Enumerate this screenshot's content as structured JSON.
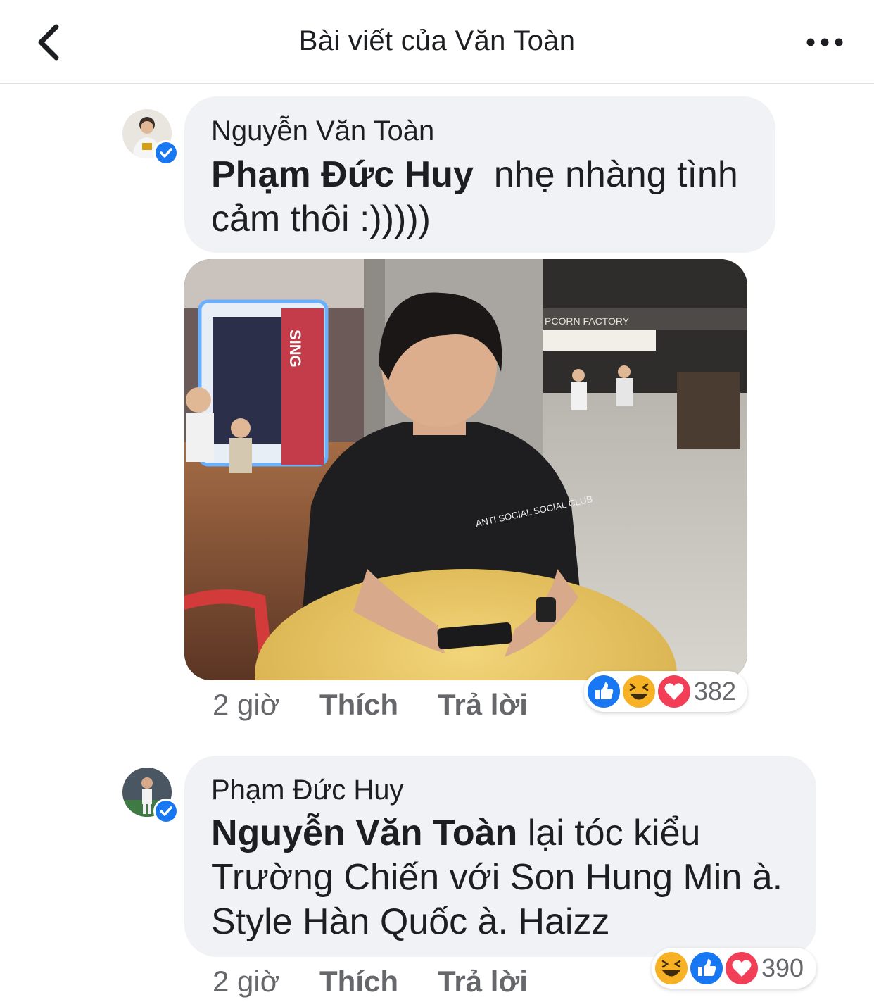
{
  "header": {
    "title": "Bài viết của Văn Toàn"
  },
  "comments": [
    {
      "author": "Nguyễn Văn Toàn",
      "mention": "Phạm Đức Huy",
      "text_line1": "  nhẹ nhàng tình",
      "text_line2": "cảm thôi :)))))",
      "has_photo": true,
      "photo_signs": {
        "sign1": "SING",
        "sign2": "PCORN FACTORY",
        "shirt": "ANTI SOCIAL SOCIAL CLUB"
      },
      "time": "2 giờ",
      "like_label": "Thích",
      "reply_label": "Trả lời",
      "reactions": [
        "like-icon",
        "haha-icon",
        "love-icon"
      ],
      "reaction_count": "382"
    },
    {
      "author": "Phạm Đức Huy",
      "mention": "Nguyễn Văn Toàn",
      "text_line1": " lại tóc kiểu",
      "text_line2": "Trường Chiến với Son Hung Min à.",
      "text_line3": "Style Hàn Quốc à. Haizz",
      "time": "2 giờ",
      "like_label": "Thích",
      "reply_label": "Trả lời",
      "reactions": [
        "haha-icon",
        "like-icon",
        "love-icon"
      ],
      "reaction_count": "390"
    }
  ],
  "colors": {
    "bubble": "#f0f2f5",
    "verified": "#1877f2",
    "like": "#1877f2",
    "love": "#f33e58",
    "haha": "#f7b125",
    "meta": "#65676b"
  }
}
